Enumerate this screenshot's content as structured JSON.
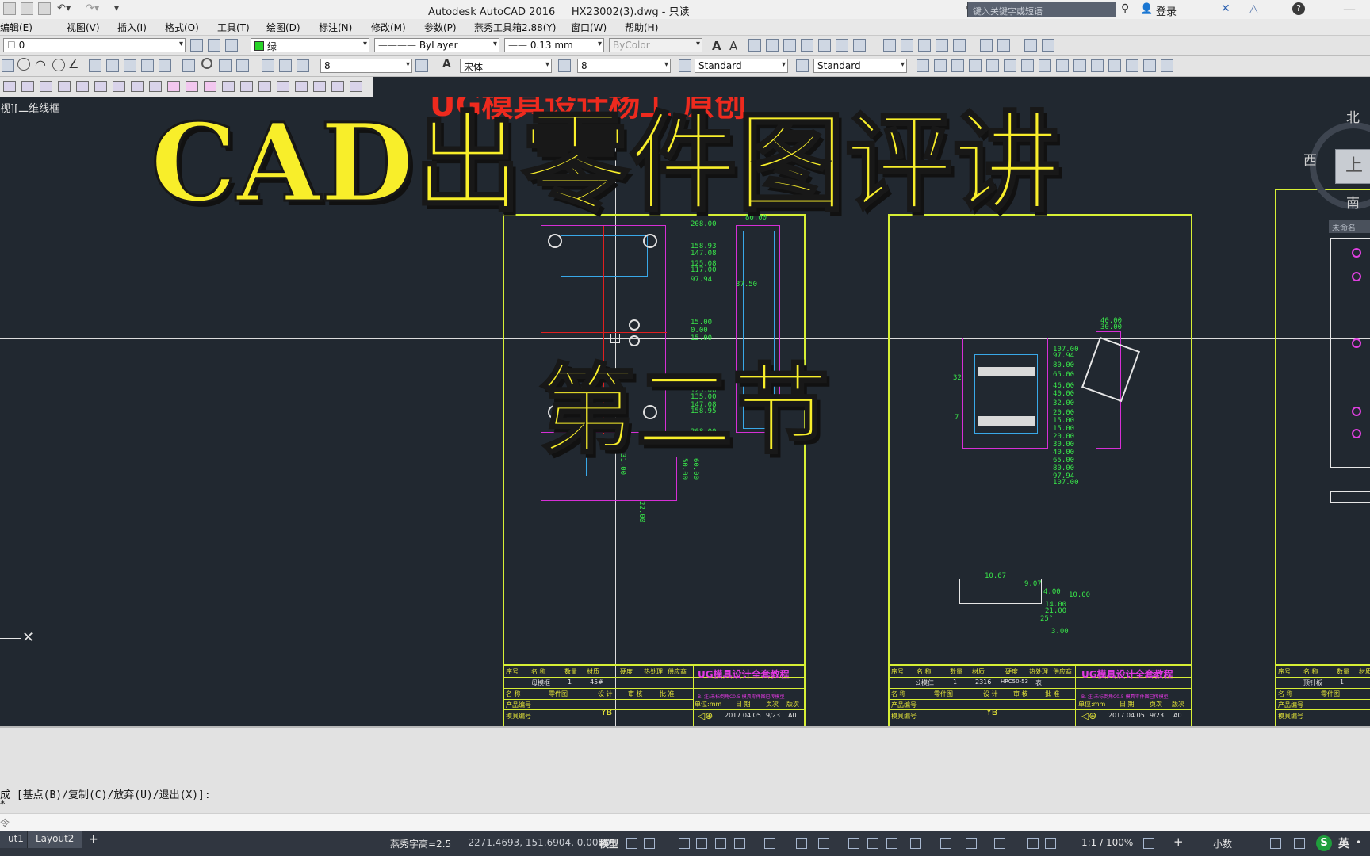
{
  "window": {
    "title": "Autodesk AutoCAD 2016     HX23002(3).dwg - 只读",
    "search_placeholder": "键入关键字或短语",
    "login": "登录"
  },
  "menu": [
    "编辑(E)",
    "视图(V)",
    "插入(I)",
    "格式(O)",
    "工具(T)",
    "绘图(D)",
    "标注(N)",
    "修改(M)",
    "参数(P)",
    "燕秀工具箱2.88(Y)",
    "窗口(W)",
    "帮助(H)"
  ],
  "toolbar1": {
    "layer": "0",
    "color": "绿",
    "linetype": "ByLayer",
    "lineweight": "0.13 mm",
    "plotstyle": "ByColor"
  },
  "toolbar2": {
    "dim_value1": "8",
    "font": "宋体",
    "dim_value2": "8",
    "text_style": "Standard",
    "dim_style": "Standard"
  },
  "viewport_label": "视][二维线框",
  "overlay": {
    "watermark": "UG模具设计杨工 原创",
    "title": "CAD出零件图评讲",
    "subtitle": "第二节"
  },
  "viewcube": {
    "north": "北",
    "south": "南",
    "west": "西",
    "top": "上",
    "unnamed": "未命名"
  },
  "drawing": {
    "sheets": [
      {
        "part_name": "母模框",
        "qty": "1",
        "material": "45#",
        "company": "UG模具设计全套教程",
        "sub_note": "B. 注:未标倒角C0.5 模具零件图已传模型",
        "mark": "YB",
        "date": "2017.04.05",
        "page": "9/23",
        "size": "A0",
        "dims_top": [
          "208.00",
          "158.93",
          "147.08",
          "125.08",
          "117.00",
          "97.94"
        ],
        "dims_mid": [
          "15.00",
          "0.00",
          "15.00"
        ],
        "dims_low": [
          "97.94",
          "117.00",
          "125.00",
          "135.00",
          "147.08",
          "158.95"
        ],
        "dims_bottom": "208.00",
        "dims_side": [
          "80.00",
          "37.50"
        ],
        "dims_section": [
          "31.00",
          "50.00",
          "60.00",
          "22.00"
        ]
      },
      {
        "part_name": "公模仁",
        "qty": "1",
        "material": "2316",
        "hardness": "HRC50-53",
        "note": "表",
        "company": "UG模具设计全套教程",
        "sub_note": "B. 注:未标倒角C0.5 模具零件图已传模型",
        "mark": "YB",
        "date": "2017.04.05",
        "page": "9/23",
        "size": "A0",
        "dims_right": [
          "40.00",
          "30.00",
          "107.00",
          "97.94",
          "80.00",
          "65.00",
          "46.00",
          "40.00",
          "32.00",
          "20.00",
          "15.00",
          "15.00",
          "20.00",
          "30.00",
          "40.00",
          "65.00",
          "80.00",
          "97.94",
          "107.00"
        ],
        "dims_left": [
          "32",
          "7"
        ],
        "dims_bottom": [
          "10.67",
          "9.07",
          "4.00",
          "10.00",
          "14.00",
          "21.00",
          "25°",
          "3.00"
        ]
      },
      {
        "part_name": "顶针板",
        "qty": "1"
      }
    ],
    "title_headers": [
      "序号",
      "名 称",
      "数量",
      "材质",
      "硬度",
      "热处理",
      "供应商"
    ],
    "title_row2": [
      "名 称",
      "零件图",
      "设 计",
      "审 核",
      "批 准"
    ],
    "title_row3": [
      "产品编号",
      "模具编号"
    ],
    "title_row4": [
      "单位:mm",
      "日 期",
      "页次",
      "版次"
    ]
  },
  "command": {
    "prompt": "成 [基点(B)/复制(C)/放弃(U)/退出(X)]:",
    "input_label": "令"
  },
  "status": {
    "tabs": [
      "ut1",
      "Layout2"
    ],
    "text_height": "燕秀字高=2.5",
    "coords": "-2271.4693, 151.6904, 0.0000",
    "space": "模型",
    "scale": "1:1 / 100%",
    "units": "小数",
    "ime": "英"
  }
}
